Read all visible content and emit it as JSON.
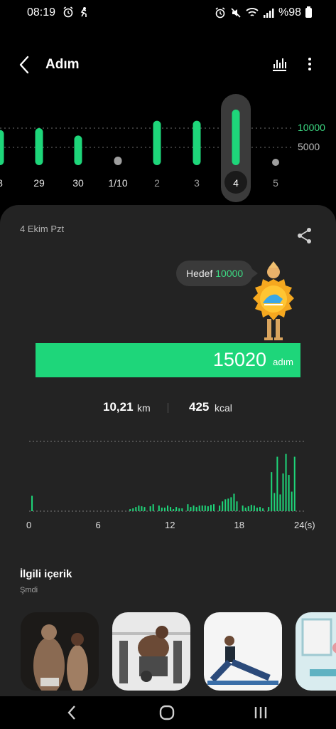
{
  "status_bar": {
    "time": "08:19",
    "battery_text": "%98"
  },
  "header": {
    "title": "Adım"
  },
  "day_chart": {
    "gridline_labels": [
      "10000",
      "5000"
    ],
    "days": [
      {
        "label": "8",
        "steps": 9500,
        "selected": false
      },
      {
        "label": "29",
        "steps": 10000,
        "selected": false
      },
      {
        "label": "30",
        "steps": 8000,
        "selected": false
      },
      {
        "label": "1/10",
        "steps": 500,
        "selected": false
      },
      {
        "label": "2",
        "steps": 12000,
        "selected": false
      },
      {
        "label": "3",
        "steps": 12000,
        "selected": false
      },
      {
        "label": "4",
        "steps": 15020,
        "selected": true
      },
      {
        "label": "5",
        "steps": 0,
        "selected": false
      }
    ],
    "colors": {
      "active": "#1ed67a",
      "inactive": "#9e9e9e"
    }
  },
  "summary": {
    "date": "4 Ekim Pzt",
    "goal_label": "Hedef",
    "goal_value": "10000",
    "steps": "15020",
    "steps_unit": "adım",
    "goal_progress": 1.0,
    "distance_value": "10,21",
    "distance_unit": "km",
    "calories_value": "425",
    "calories_unit": "kcal"
  },
  "chart_data": {
    "type": "bar",
    "xlabel": "",
    "ylabel": "",
    "x_ticks": [
      "0",
      "6",
      "12",
      "18",
      "24(s)"
    ],
    "series": [
      {
        "values": [
          0,
          0,
          0,
          0,
          0,
          0,
          0,
          0,
          0,
          0,
          0,
          0,
          0,
          0,
          0,
          0,
          0,
          0,
          0,
          0,
          0,
          0,
          0,
          0,
          0,
          0,
          0,
          0,
          0,
          0,
          0,
          0,
          0,
          0,
          0,
          0,
          0,
          0,
          0,
          0,
          0,
          0,
          0,
          0,
          0,
          0,
          0,
          0,
          0,
          0,
          0,
          0,
          0,
          0,
          0,
          0,
          0,
          0,
          0,
          0,
          0,
          0,
          0,
          0,
          0,
          0,
          0,
          0,
          0,
          0,
          0,
          0,
          0,
          0,
          0,
          0,
          0,
          0,
          0,
          0,
          0,
          0,
          0,
          0,
          0,
          0,
          0,
          0,
          0,
          0,
          0,
          0,
          0,
          0,
          0,
          0
        ],
        "sparse": [
          [
            1,
            22
          ],
          [
            35,
            3
          ],
          [
            36,
            4
          ],
          [
            37,
            6
          ],
          [
            38,
            8
          ],
          [
            39,
            7
          ],
          [
            40,
            6
          ],
          [
            42,
            7
          ],
          [
            43,
            10
          ],
          [
            45,
            8
          ],
          [
            46,
            5
          ],
          [
            47,
            5
          ],
          [
            48,
            8
          ],
          [
            49,
            6
          ],
          [
            50,
            3
          ],
          [
            51,
            6
          ],
          [
            52,
            4
          ],
          [
            53,
            4
          ],
          [
            55,
            10
          ],
          [
            56,
            6
          ],
          [
            57,
            8
          ],
          [
            58,
            6
          ],
          [
            59,
            8
          ],
          [
            60,
            8
          ],
          [
            61,
            8
          ],
          [
            62,
            7
          ],
          [
            63,
            9
          ],
          [
            64,
            10
          ],
          [
            66,
            8
          ],
          [
            67,
            14
          ],
          [
            68,
            17
          ],
          [
            69,
            18
          ],
          [
            70,
            20
          ],
          [
            71,
            25
          ],
          [
            72,
            14
          ],
          [
            74,
            8
          ],
          [
            75,
            5
          ],
          [
            76,
            7
          ],
          [
            77,
            9
          ],
          [
            78,
            8
          ],
          [
            79,
            5
          ],
          [
            80,
            6
          ],
          [
            81,
            4
          ],
          [
            83,
            6
          ],
          [
            84,
            56
          ],
          [
            85,
            26
          ],
          [
            86,
            78
          ],
          [
            87,
            24
          ],
          [
            88,
            54
          ],
          [
            89,
            82
          ],
          [
            90,
            52
          ],
          [
            91,
            28
          ],
          [
            92,
            78
          ]
        ]
      }
    ],
    "x_range": [
      0,
      96
    ],
    "y_range": [
      0,
      100
    ],
    "grid": true
  },
  "related": {
    "title": "İlgili içerik",
    "subtitle": "Şmdi"
  }
}
